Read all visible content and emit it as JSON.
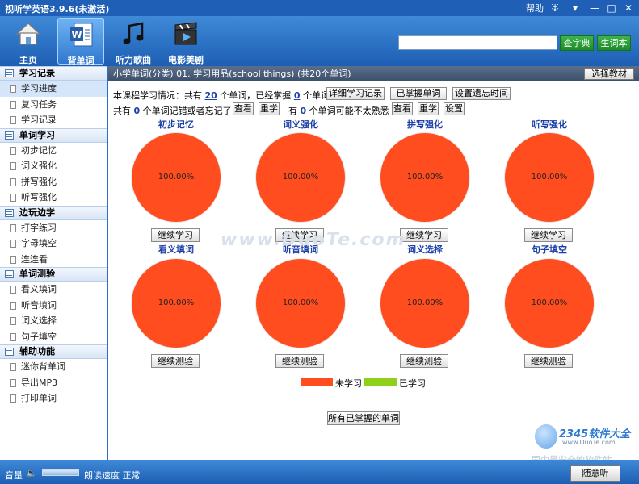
{
  "window": {
    "title": "视听学英语3.9.6(未激活)",
    "help": "帮助",
    "controls": [
      "♅",
      "▾",
      "—",
      "□",
      "✕"
    ]
  },
  "toolbar": {
    "nav": [
      {
        "label": "主页",
        "icon": "home-icon"
      },
      {
        "label": "背单词",
        "icon": "word-doc-icon"
      },
      {
        "label": "听力歌曲",
        "icon": "music-note-icon"
      },
      {
        "label": "电影美剧",
        "icon": "film-clapper-icon"
      }
    ],
    "search_value": "",
    "lookup_label": "查字典",
    "wordbook_label": "生词本"
  },
  "sidebar": {
    "sections": [
      {
        "title": "学习记录",
        "items": [
          "学习进度",
          "复习任务",
          "学习记录"
        ]
      },
      {
        "title": "单词学习",
        "items": [
          "初步记忆",
          "词义强化",
          "拼写强化",
          "听写强化"
        ]
      },
      {
        "title": "边玩边学",
        "items": [
          "打字练习",
          "字母填空",
          "连连看"
        ]
      },
      {
        "title": "单词测验",
        "items": [
          "看义填词",
          "听音填词",
          "词义选择",
          "句子填空"
        ]
      },
      {
        "title": "辅助功能",
        "items": [
          "迷你背单词",
          "导出MP3",
          "打印单词"
        ]
      }
    ]
  },
  "main": {
    "course_title": "小学单词(分类) 01. 学习用品(school things) (共20个单词)",
    "select_course": "选择教材",
    "stats1": {
      "prefix": "本课程学习情况：共有",
      "total": "20",
      "mid": "个单词，已经掌握",
      "mastered": "0",
      "suffix": "个单词；"
    },
    "stats1_buttons": [
      "详细学习记录",
      "已掌握单词",
      "设置遗忘时间"
    ],
    "stats2": {
      "prefix": "共有",
      "forgot": "0",
      "mid": "个单词记错或者忘记了",
      "mid2": "有",
      "unsure": "0",
      "suffix": "个单词可能不太熟悉"
    },
    "view_label": "查看",
    "relearn_label": "重学",
    "settings_label": "设置",
    "pies_top": [
      {
        "title": "初步记忆",
        "value": "100.00%",
        "button": "继续学习"
      },
      {
        "title": "词义强化",
        "value": "100.00%",
        "button": "继续学习"
      },
      {
        "title": "拼写强化",
        "value": "100.00%",
        "button": "继续学习"
      },
      {
        "title": "听写强化",
        "value": "100.00%",
        "button": "继续学习"
      }
    ],
    "pies_bottom": [
      {
        "title": "看义填词",
        "value": "100.00%",
        "button": "继续测验"
      },
      {
        "title": "听音填词",
        "value": "100.00%",
        "button": "继续测验"
      },
      {
        "title": "词义选择",
        "value": "100.00%",
        "button": "继续测验"
      },
      {
        "title": "句子填空",
        "value": "100.00%",
        "button": "继续测验"
      }
    ],
    "legend": [
      {
        "label": "未学习",
        "color": "#ff4d1f"
      },
      {
        "label": "已学习",
        "color": "#8fd01b"
      }
    ],
    "mastered_all": "所有已掌握的单词",
    "watermark": "www.DuoTe.com",
    "logo": {
      "brand": "2345软件大全",
      "url": "www.DuoTe.com",
      "slogan": "国内最安全的软件站"
    }
  },
  "status": {
    "volume": "音量",
    "speed_label": "朗读速度",
    "speed_value": "正常",
    "random_listen": "随意听"
  }
}
